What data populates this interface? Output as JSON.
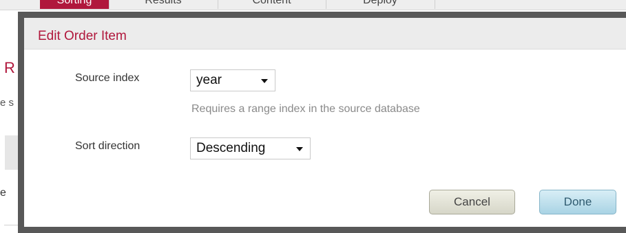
{
  "background": {
    "tabs": [
      {
        "label": "Sorting",
        "active": true
      },
      {
        "label": "Results",
        "active": false
      },
      {
        "label": "Content",
        "active": false
      },
      {
        "label": "Deploy",
        "active": false
      }
    ],
    "heading_fragment": "R",
    "subtext_fragment": "e s",
    "row_fragment": "e"
  },
  "dialog": {
    "title": "Edit Order Item",
    "source_index": {
      "label": "Source index",
      "value": "year",
      "hint": "Requires a range index in the source database"
    },
    "sort_direction": {
      "label": "Sort direction",
      "value": "Descending"
    },
    "buttons": {
      "cancel": "Cancel",
      "done": "Done"
    }
  },
  "colors": {
    "accent": "#b0173c",
    "overlay_frame": "#585858",
    "done_button": "#a9d3e4",
    "cancel_button": "#d6d6c8"
  }
}
